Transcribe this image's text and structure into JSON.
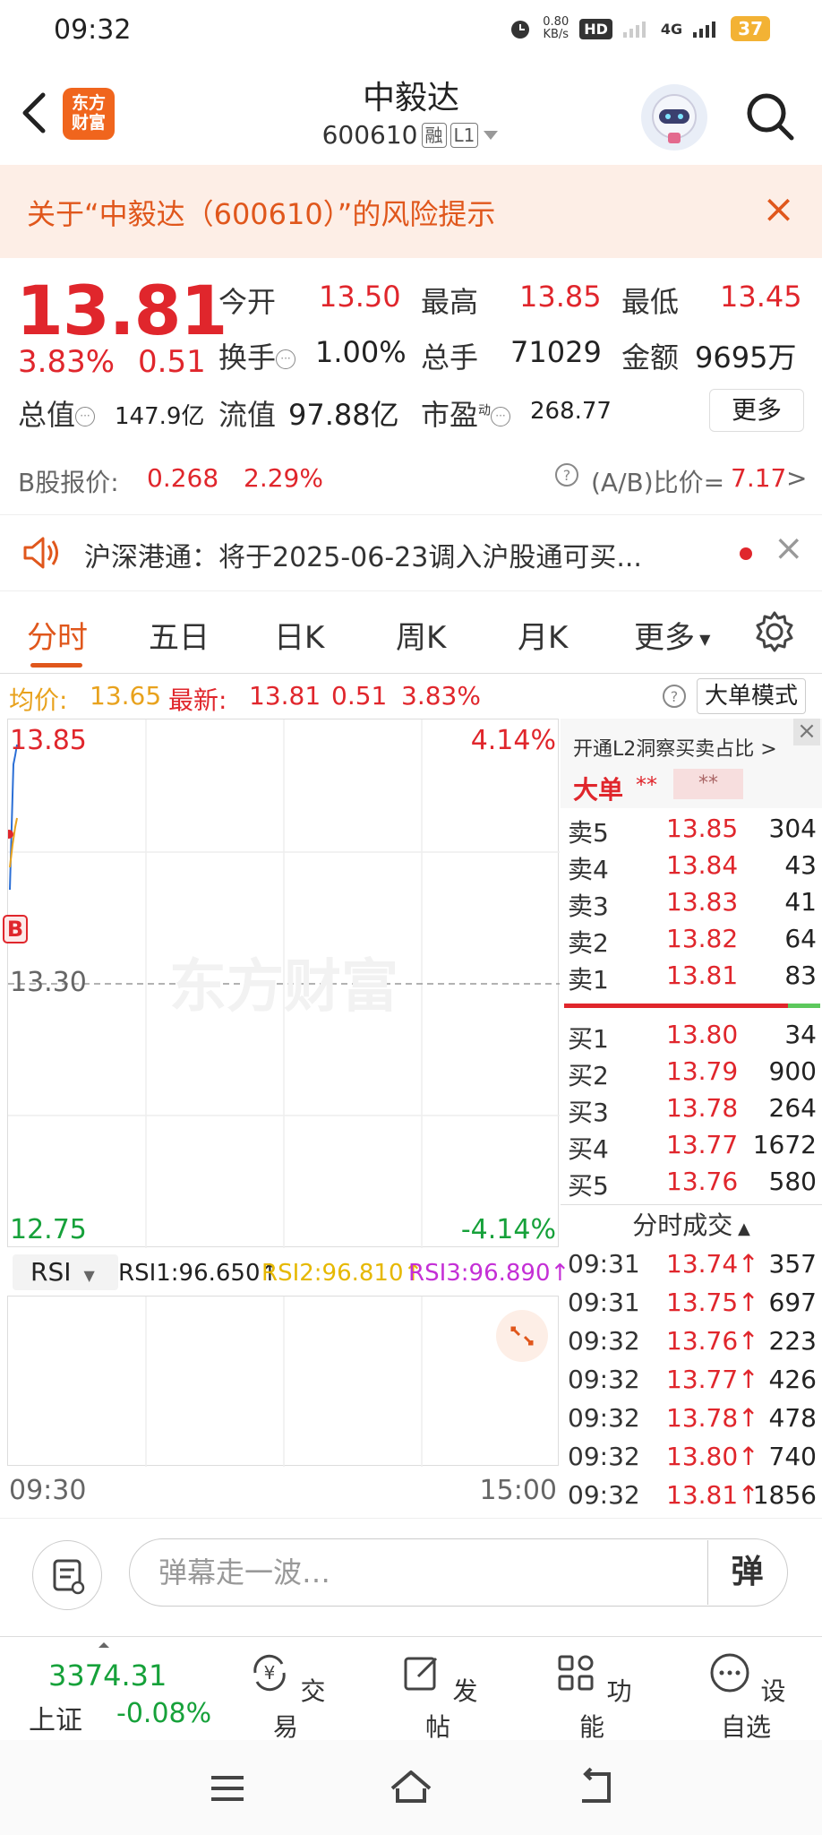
{
  "status": {
    "time": "09:32",
    "net_speed": "0.80",
    "net_unit": "KB/s",
    "hd": "HD",
    "signal": "4G",
    "battery": "37"
  },
  "header": {
    "logo_line1": "东方",
    "logo_line2": "财富",
    "stock_name": "中毅达",
    "stock_code": "600610",
    "tag_margin": "融",
    "tag_level": "L1"
  },
  "risk": {
    "text": "关于“中毅达（600610）”的风险提示",
    "close": "×"
  },
  "quote": {
    "price": "13.81",
    "change_pct": "3.83%",
    "change_amt": "0.51",
    "open_label": "今开",
    "open": "13.50",
    "high_label": "最高",
    "high": "13.85",
    "low_label": "最低",
    "low": "13.45",
    "turnover_label": "换手",
    "turnover": "1.00%",
    "volume_label": "总手",
    "volume": "71029",
    "amount_label": "金额",
    "amount": "9695万",
    "total_mv_label": "总值",
    "total_mv": "147.9亿",
    "float_mv_label": "流值",
    "float_mv": "97.88亿",
    "pe_label": "市盈",
    "pe_sup": "动",
    "pe": "268.77",
    "more": "更多"
  },
  "b_share": {
    "label": "B股报价:",
    "price": "0.268",
    "pct": "2.29%",
    "ratio_label": "(A/B)比价=",
    "ratio": "7.17",
    "arrow": ">"
  },
  "notice": {
    "text": "沪深港通：将于2025-06-23调入沪股通可买..."
  },
  "tabs": [
    "分时",
    "五日",
    "日K",
    "周K",
    "月K",
    "更多"
  ],
  "avg_row": {
    "avg_label": "均价:",
    "avg": "13.65",
    "latest_label": "最新:",
    "latest": "13.81",
    "chg": "0.51",
    "pct": "3.83%",
    "big_mode": "大单模式"
  },
  "chart": {
    "top_left": "13.85",
    "top_right": "4.14%",
    "mid": "13.30",
    "bottom_left": "12.75",
    "bottom_right": "-4.14%",
    "b_marker": "B",
    "watermark": "东方财富",
    "time_start": "09:30",
    "time_end": "15:00"
  },
  "rsi": {
    "selector": "RSI",
    "rsi1": "RSI1:96.650↑",
    "rsi2": "RSI2:96.810↑",
    "rsi3": "RSI3:96.890↑"
  },
  "book": {
    "l2_text": "开通L2洞察买卖占比 >",
    "big_label": "大单",
    "big_v1": "**",
    "big_v2": "**",
    "sells": [
      {
        "n": "卖5",
        "p": "13.85",
        "v": "304"
      },
      {
        "n": "卖4",
        "p": "13.84",
        "v": "43"
      },
      {
        "n": "卖3",
        "p": "13.83",
        "v": "41"
      },
      {
        "n": "卖2",
        "p": "13.82",
        "v": "64"
      },
      {
        "n": "卖1",
        "p": "13.81",
        "v": "83"
      }
    ],
    "buys": [
      {
        "n": "买1",
        "p": "13.80",
        "v": "34"
      },
      {
        "n": "买2",
        "p": "13.79",
        "v": "900"
      },
      {
        "n": "买3",
        "p": "13.78",
        "v": "264"
      },
      {
        "n": "买4",
        "p": "13.77",
        "v": "1672"
      },
      {
        "n": "买5",
        "p": "13.76",
        "v": "580"
      }
    ],
    "trades_label": "分时成交",
    "trades": [
      {
        "t": "09:31",
        "p": "13.74↑",
        "v": "357"
      },
      {
        "t": "09:31",
        "p": "13.75↑",
        "v": "697"
      },
      {
        "t": "09:32",
        "p": "13.76↑",
        "v": "223"
      },
      {
        "t": "09:32",
        "p": "13.77↑",
        "v": "426"
      },
      {
        "t": "09:32",
        "p": "13.78↑",
        "v": "478"
      },
      {
        "t": "09:32",
        "p": "13.80↑",
        "v": "740"
      },
      {
        "t": "09:32",
        "p": "13.81↑",
        "v": "1856"
      }
    ]
  },
  "comment": {
    "placeholder": "弹幕走一波…",
    "danmu_btn": "弹"
  },
  "nav": {
    "index_value": "3374.31",
    "index_name": "上证",
    "index_pct": "-0.08%",
    "items": [
      "交易",
      "发帖",
      "功能",
      "设自选"
    ]
  },
  "colors": {
    "up": "#e0262c",
    "down": "#16a13a",
    "accent": "#e0571c"
  }
}
